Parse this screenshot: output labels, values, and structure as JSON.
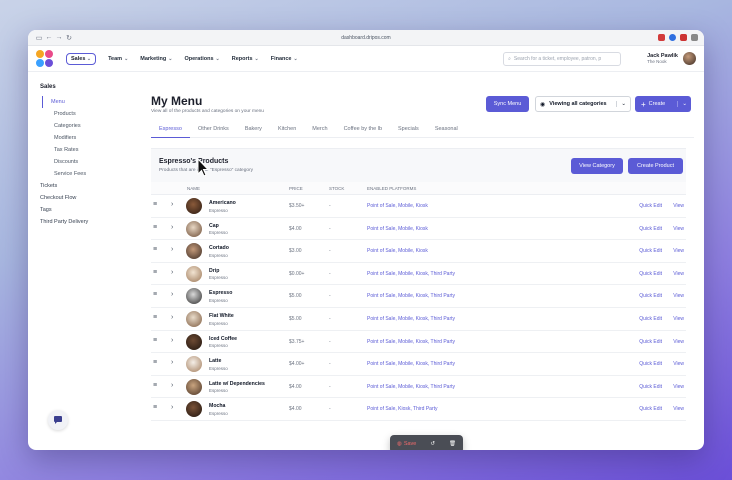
{
  "browser": {
    "url": "dashboard.dripos.com"
  },
  "topnav": {
    "location_pill": "Sales",
    "items": [
      "Team",
      "Marketing",
      "Operations",
      "Reports",
      "Finance"
    ],
    "search_placeholder": "Search for a ticket, employee, patron, p",
    "user_name": "Jack Pawlik",
    "user_shop": "The Nook"
  },
  "sidebar": {
    "section": "Sales",
    "items": [
      {
        "label": "Menu",
        "level": 0,
        "active": true
      },
      {
        "label": "Products",
        "level": 1
      },
      {
        "label": "Categories",
        "level": 1
      },
      {
        "label": "Modifiers",
        "level": 1
      },
      {
        "label": "Tax Rates",
        "level": 1
      },
      {
        "label": "Discounts",
        "level": 1
      },
      {
        "label": "Service Fees",
        "level": 1
      },
      {
        "label": "Tickets",
        "level": 0
      },
      {
        "label": "Checkout Flow",
        "level": 0
      },
      {
        "label": "Tags",
        "level": 0
      },
      {
        "label": "Third Party Delivery",
        "level": 0
      }
    ]
  },
  "page": {
    "title": "My Menu",
    "subtitle": "View all of the products and categories on your menu",
    "sync_button": "Sync Menu",
    "viewing_button": "Viewing all categories",
    "create_button": "Create"
  },
  "tabs": [
    "Espresso",
    "Other Drinks",
    "Bakery",
    "Kitchen",
    "Merch",
    "Coffee by the lb",
    "Specials",
    "Seasonal"
  ],
  "card": {
    "title": "Espresso's Products",
    "subtitle": "Products that are in the \"Espresso\" category",
    "view_category": "View Category",
    "create_product": "Create Product"
  },
  "table": {
    "headers": [
      "NAME",
      "PRICE",
      "STOCK",
      "ENABLED PLATFORMS"
    ],
    "rows": [
      {
        "name": "Americano",
        "category": "Espresso",
        "price": "$3.50+",
        "stock": "-",
        "platforms": "Point of Sale, Mobile, Kiosk"
      },
      {
        "name": "Cap",
        "category": "Espresso",
        "price": "$4.00",
        "stock": "-",
        "platforms": "Point of Sale, Mobile, Kiosk"
      },
      {
        "name": "Cortado",
        "category": "Espresso",
        "price": "$3.00",
        "stock": "-",
        "platforms": "Point of Sale, Mobile, Kiosk"
      },
      {
        "name": "Drip",
        "category": "Espresso",
        "price": "$0.00+",
        "stock": "-",
        "platforms": "Point of Sale, Mobile, Kiosk, Third Party"
      },
      {
        "name": "Espresso",
        "category": "Espresso",
        "price": "$5.00",
        "stock": "-",
        "platforms": "Point of Sale, Mobile, Kiosk, Third Party"
      },
      {
        "name": "Flat White",
        "category": "Espresso",
        "price": "$5.00",
        "stock": "-",
        "platforms": "Point of Sale, Mobile, Kiosk, Third Party"
      },
      {
        "name": "Iced Coffee",
        "category": "Espresso",
        "price": "$3.75+",
        "stock": "-",
        "platforms": "Point of Sale, Mobile, Kiosk, Third Party"
      },
      {
        "name": "Latte",
        "category": "Espresso",
        "price": "$4.00+",
        "stock": "-",
        "platforms": "Point of Sale, Mobile, Kiosk, Third Party"
      },
      {
        "name": "Latte w/ Dependencies",
        "category": "Espresso",
        "price": "$4.00",
        "stock": "-",
        "platforms": "Point of Sale, Mobile, Kiosk, Third Party"
      },
      {
        "name": "Mocha",
        "category": "Espresso",
        "price": "$4.00",
        "stock": "-",
        "platforms": "Point of Sale, Kiosk, Third Party"
      }
    ],
    "quick_edit": "Quick Edit",
    "view": "View"
  },
  "floating_toolbar": {
    "save_label": "Save"
  },
  "colors": {
    "accent": "#5b5bd6",
    "text": "#1c1f2b",
    "muted": "#6b7280"
  }
}
